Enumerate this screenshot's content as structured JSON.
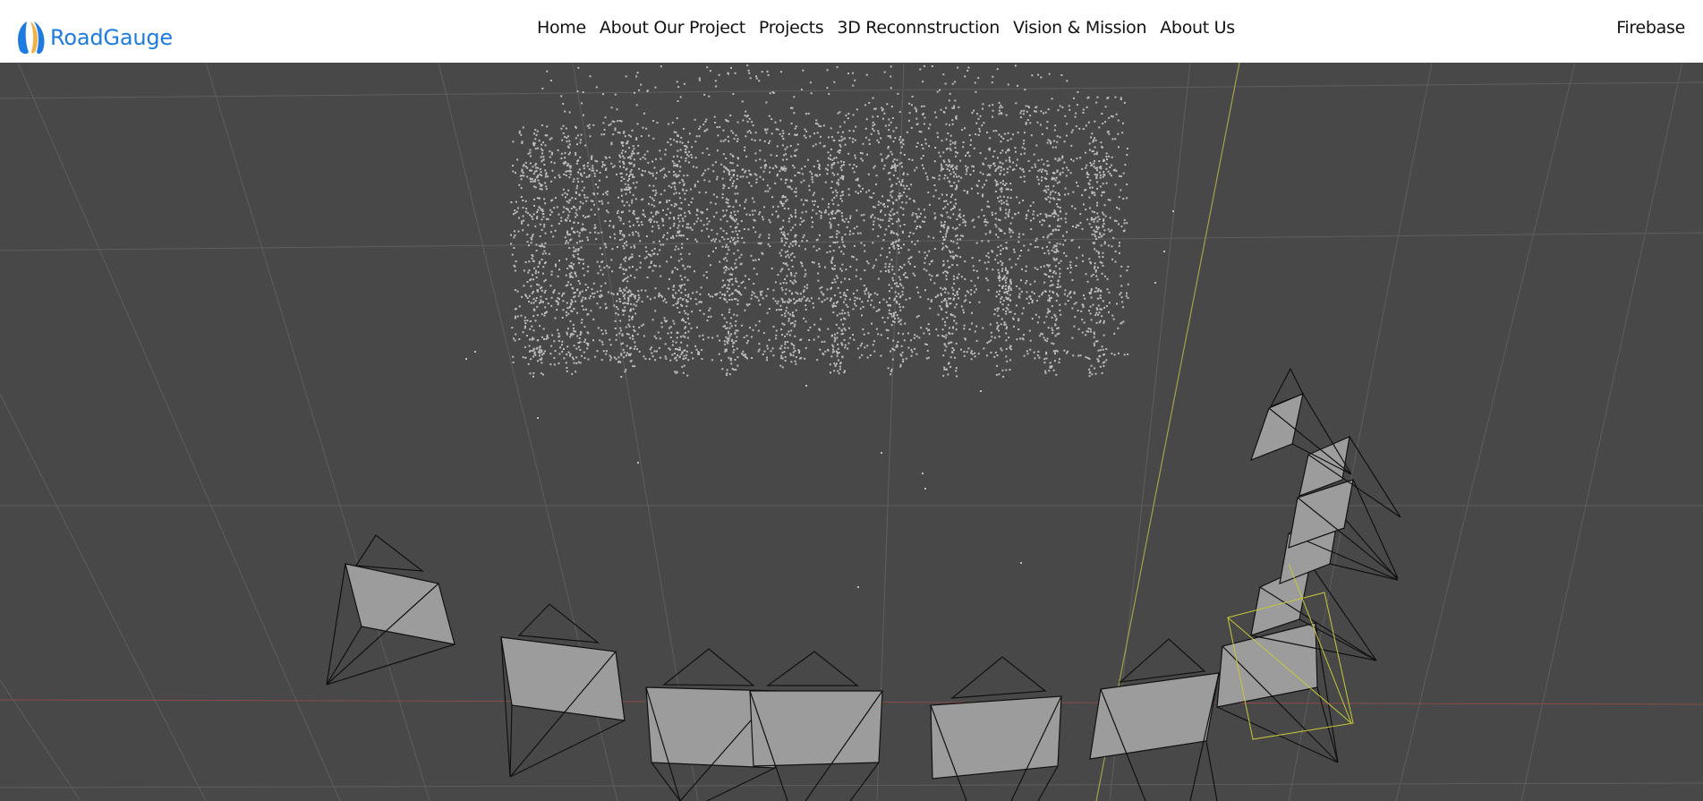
{
  "brand": {
    "name": "RoadGauge",
    "logo_icon": "roadgauge-logo-icon",
    "color": "#1e7be0"
  },
  "nav": {
    "items": [
      {
        "label": "Home"
      },
      {
        "label": "About Our Project"
      },
      {
        "label": "Projects"
      },
      {
        "label": "3D Reconnstruction"
      },
      {
        "label": "Vision & Mission"
      },
      {
        "label": "About Us"
      }
    ],
    "right_label": "Firebase"
  },
  "viewport": {
    "background": "#484848",
    "content": "3d-reconstruction-point-cloud-with-camera-frustums"
  }
}
